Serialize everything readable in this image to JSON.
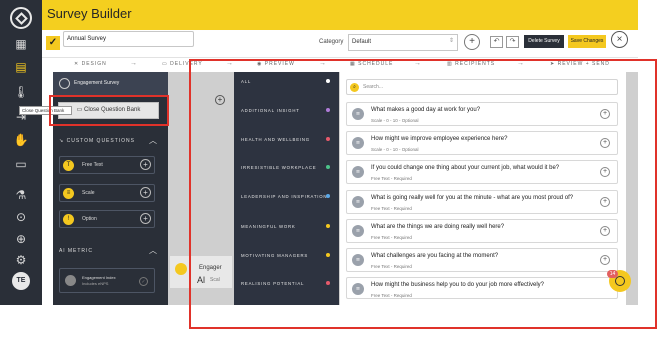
{
  "app": {
    "title": "Survey Builder"
  },
  "toolbar": {
    "survey_name": "Annual Survey",
    "category_label": "Category",
    "category_value": "Default",
    "delete_label": "Delete Survey",
    "save_label": "Save Changes"
  },
  "steps": [
    {
      "label": "DESIGN"
    },
    {
      "label": "DELIVERY"
    },
    {
      "label": "PREVIEW"
    },
    {
      "label": "SCHEDULE"
    },
    {
      "label": "RECIPIENTS"
    },
    {
      "label": "REVIEW + SEND"
    }
  ],
  "design_panel": {
    "header": "Engagement Survey",
    "close_bank_label": "Close Question Bank",
    "tooltip": "Close Question Bank",
    "custom_heading": "CUSTOM QUESTIONS",
    "types": [
      {
        "label": "Free Text",
        "icon": "text-icon"
      },
      {
        "label": "Scale",
        "icon": "scale-icon"
      },
      {
        "label": "Option",
        "icon": "option-icon"
      }
    ],
    "metric_heading": "METRIC",
    "metric_name": "Engagement Index",
    "metric_sub": "Includes eNPS"
  },
  "canvas": {
    "card_title": "Engager",
    "card_sub": "Scal"
  },
  "categories": [
    {
      "label": "ALL",
      "color": "#ffffff"
    },
    {
      "label": "ADDITIONAL INSIGHT",
      "color": "#b07cd8"
    },
    {
      "label": "HEALTH AND WELLBEING",
      "color": "#e65a6b"
    },
    {
      "label": "IRRESISTIBLE WORKPLACE",
      "color": "#4cc38a"
    },
    {
      "label": "LEADERSHIP AND INSPIRATION",
      "color": "#5aa8e8"
    },
    {
      "label": "MEANINGFUL WORK",
      "color": "#f4c81f"
    },
    {
      "label": "MOTIVATING MANAGERS",
      "color": "#f4c81f"
    },
    {
      "label": "REALISING POTENTIAL",
      "color": "#e65a6b"
    }
  ],
  "search": {
    "placeholder": "Search..."
  },
  "questions": [
    {
      "text": "What makes a good day at work for you?",
      "sub": "Scale - 0 - 10 - Optional"
    },
    {
      "text": "How might we improve employee experience here?",
      "sub": "Scale - 0 - 10 - Optional"
    },
    {
      "text": "If you could change one thing about your current job, what would it be?",
      "sub": "Free Text - Required"
    },
    {
      "text": "What is going really well for you at the minute - what are you most proud of?",
      "sub": "Free Text - Required"
    },
    {
      "text": "What are the things we are doing really well here?",
      "sub": "Free Text - Required"
    },
    {
      "text": "What challenges are you facing at the moment?",
      "sub": "Free Text - Required"
    },
    {
      "text": "How might the business help you to do your job more effectively?",
      "sub": "Free Text - Required"
    }
  ],
  "badge": {
    "count": "14"
  }
}
